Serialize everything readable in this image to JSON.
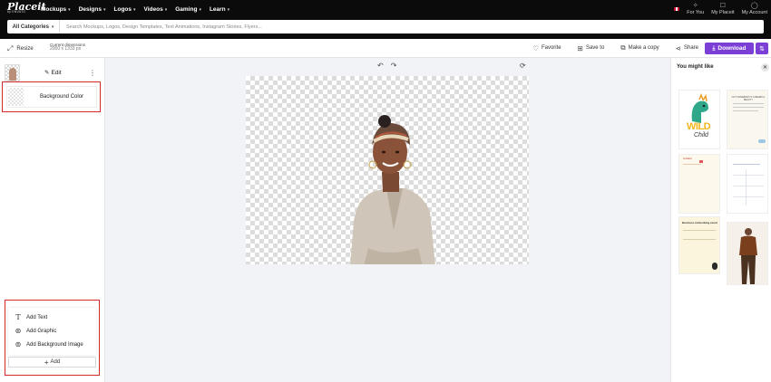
{
  "nav": {
    "brand": "Placeit",
    "brand_sub": "by ENVATO",
    "items": [
      {
        "label": "Mockups"
      },
      {
        "label": "Designs"
      },
      {
        "label": "Logos"
      },
      {
        "label": "Videos"
      },
      {
        "label": "Gaming"
      },
      {
        "label": "Learn"
      }
    ],
    "right": [
      {
        "label": "For You",
        "icon": "sparkle-icon"
      },
      {
        "label": "My Placeit",
        "icon": "bookmark-icon"
      },
      {
        "label": "My Account",
        "icon": "user-icon"
      }
    ]
  },
  "search": {
    "category": "All Categories",
    "placeholder": "Search Mockups, Logos, Design Templates, Text Animations, Instagram Stories, Flyers..."
  },
  "toolbar": {
    "resize_label": "Resize",
    "dims_title": "Current dimensions",
    "dims_value": "2000 x 1333 px",
    "favorite_label": "Favorite",
    "save_label": "Save to",
    "copy_label": "Make a copy",
    "share_label": "Share",
    "download_label": "Download"
  },
  "layers": {
    "edit_label": "Edit",
    "background_label": "Background Color"
  },
  "add_menu": {
    "items": [
      {
        "label": "Add Text",
        "icon": "text-icon"
      },
      {
        "label": "Add Graphic",
        "icon": "graphic-icon"
      },
      {
        "label": "Add Background Image",
        "icon": "image-icon"
      }
    ],
    "button_label": "Add"
  },
  "right_panel": {
    "title": "You might like",
    "thumbs": {
      "t1_text": "WILD",
      "t1_sub": "Child",
      "t2_text": "GOT SOMEBODY'S CHEERFUL BEAUTY",
      "t5_text": "Business networking event",
      "t3_text": "Invitation"
    }
  },
  "colors": {
    "accent": "#7b3fd6",
    "highlight": "#d42a2a",
    "nav_bg": "#0b0b0c"
  }
}
